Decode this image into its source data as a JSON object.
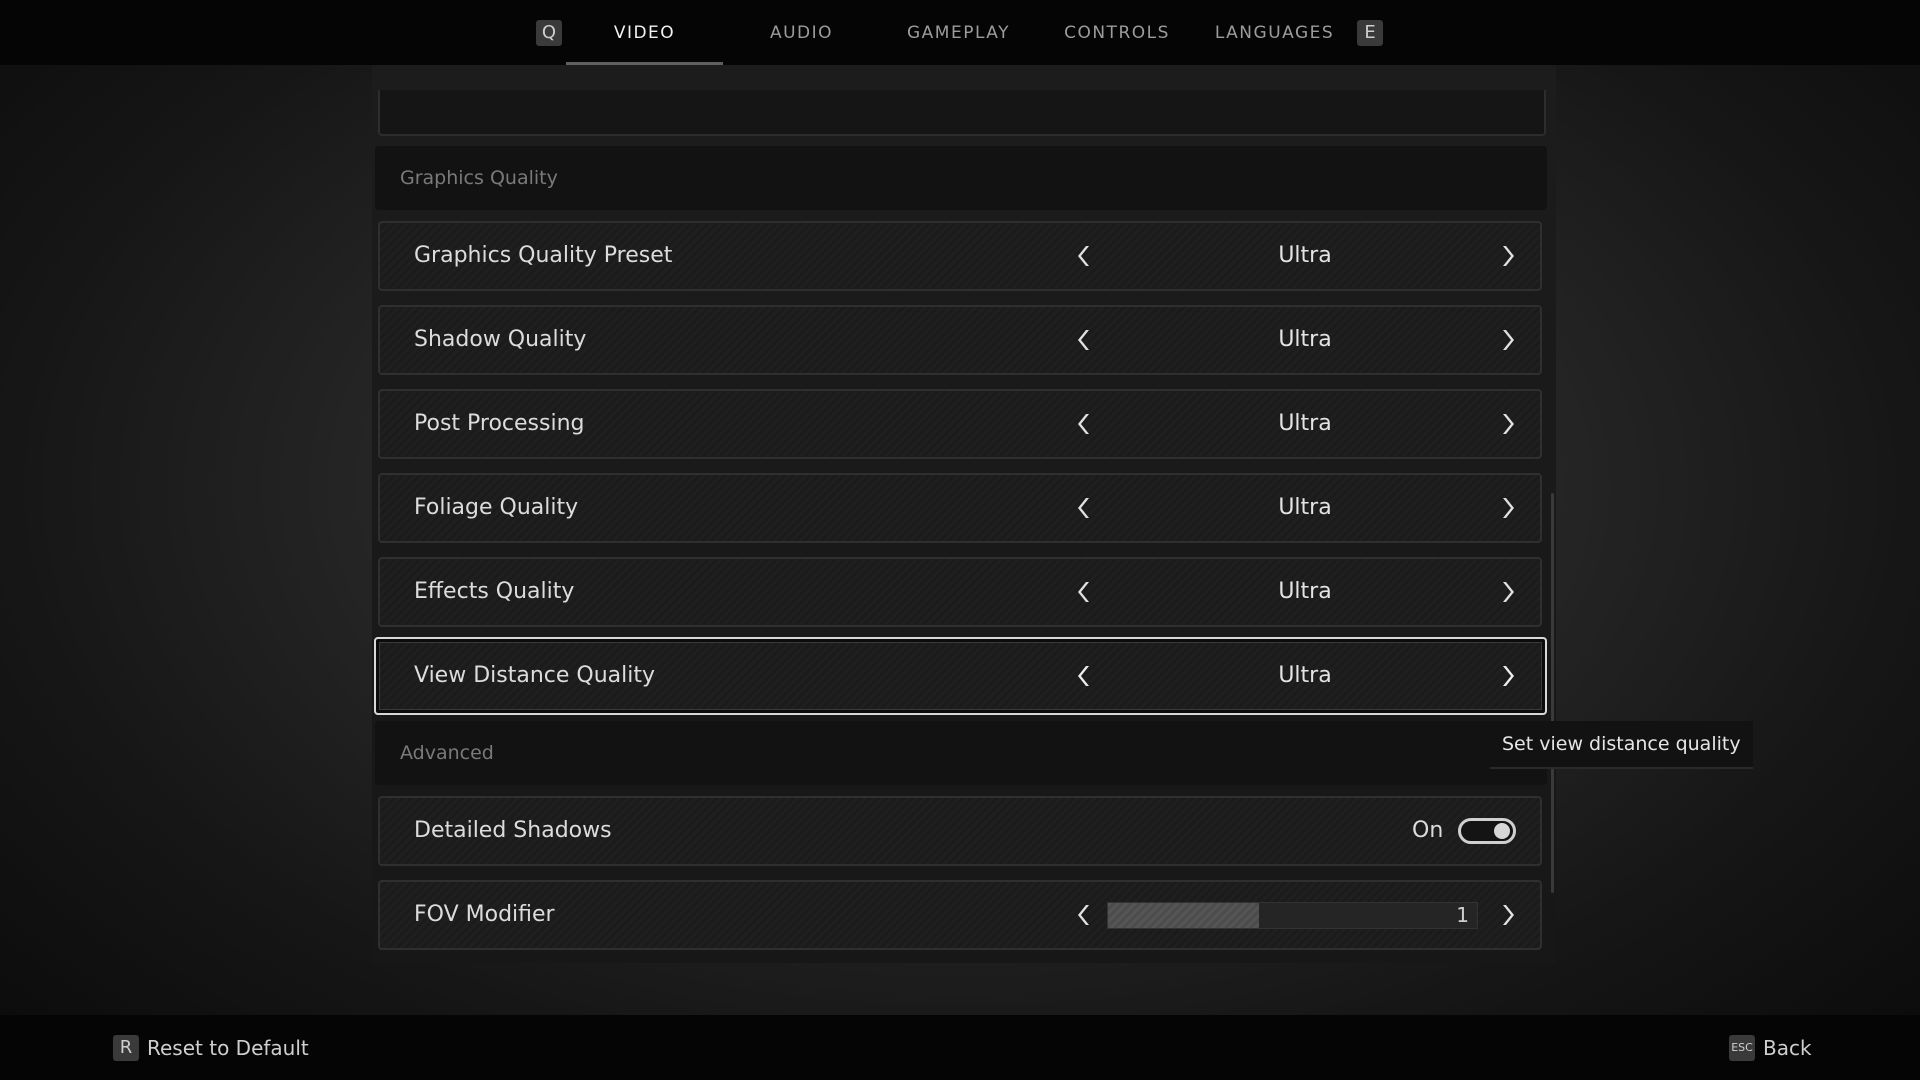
{
  "topbar": {
    "prev_key": "Q",
    "next_key": "E",
    "tabs": [
      {
        "label": "VIDEO",
        "active": true
      },
      {
        "label": "AUDIO",
        "active": false
      },
      {
        "label": "GAMEPLAY",
        "active": false
      },
      {
        "label": "CONTROLS",
        "active": false
      },
      {
        "label": "LANGUAGES",
        "active": false
      }
    ]
  },
  "sections": {
    "graphics_quality": "Graphics Quality",
    "advanced": "Advanced"
  },
  "settings": {
    "graphics_quality_preset": {
      "label": "Graphics Quality Preset",
      "value": "Ultra"
    },
    "shadow_quality": {
      "label": "Shadow Quality",
      "value": "Ultra"
    },
    "post_processing": {
      "label": "Post Processing",
      "value": "Ultra"
    },
    "foliage_quality": {
      "label": "Foliage Quality",
      "value": "Ultra"
    },
    "effects_quality": {
      "label": "Effects Quality",
      "value": "Ultra"
    },
    "view_distance_quality": {
      "label": "View Distance Quality",
      "value": "Ultra",
      "selected": true
    },
    "detailed_shadows": {
      "label": "Detailed Shadows",
      "value": "On",
      "enabled": true
    },
    "fov_modifier": {
      "label": "FOV Modifier",
      "value": "1",
      "fill_fraction": 0.41
    }
  },
  "tooltip": {
    "text": "Set view distance quality"
  },
  "footer": {
    "reset_key": "R",
    "reset_label": "Reset to Default",
    "back_key": "ESC",
    "back_label": "Back"
  }
}
